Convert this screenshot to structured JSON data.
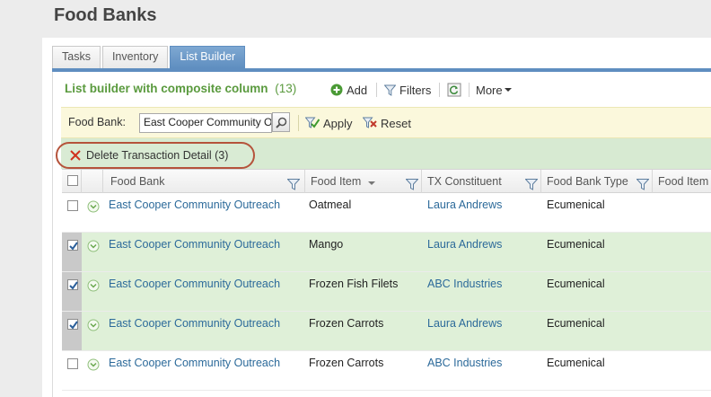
{
  "page": {
    "title": "Food Banks"
  },
  "tabs": [
    {
      "label": "Tasks"
    },
    {
      "label": "Inventory"
    },
    {
      "label": "List Builder"
    }
  ],
  "list": {
    "title": "List builder with composite column",
    "count": "(13)"
  },
  "toolbar": {
    "add": "Add",
    "filters": "Filters",
    "more": "More"
  },
  "filter_bar": {
    "label": "Food Bank:",
    "value": "East Cooper Community O",
    "apply": "Apply",
    "reset": "Reset"
  },
  "action": {
    "delete": "Delete Transaction Detail (3)"
  },
  "grid": {
    "columns": [
      "Food Bank",
      "Food Item",
      "TX Constituent",
      "Food Bank Type",
      "Food Item"
    ],
    "rows": [
      {
        "food_bank": "East Cooper Community Outreach",
        "food_item": "Oatmeal",
        "constituent": "Laura Andrews",
        "type": "Ecumenical",
        "selected": false
      },
      {
        "food_bank": "East Cooper Community Outreach",
        "food_item": "Mango",
        "constituent": "Laura Andrews",
        "type": "Ecumenical",
        "selected": true
      },
      {
        "food_bank": "East Cooper Community Outreach",
        "food_item": "Frozen Fish Filets",
        "constituent": "ABC Industries",
        "type": "Ecumenical",
        "selected": true
      },
      {
        "food_bank": "East Cooper Community Outreach",
        "food_item": "Frozen Carrots",
        "constituent": "Laura Andrews",
        "type": "Ecumenical",
        "selected": true
      },
      {
        "food_bank": "East Cooper Community Outreach",
        "food_item": "Frozen Carrots",
        "constituent": "ABC Industries",
        "type": "Ecumenical",
        "selected": false
      }
    ]
  },
  "colors": {
    "accent_blue": "#5f8ec0",
    "title_green": "#5a9a3e",
    "selected_row": "#dff0d8",
    "link": "#2c6a9a",
    "delete_outline": "#b5533b"
  }
}
